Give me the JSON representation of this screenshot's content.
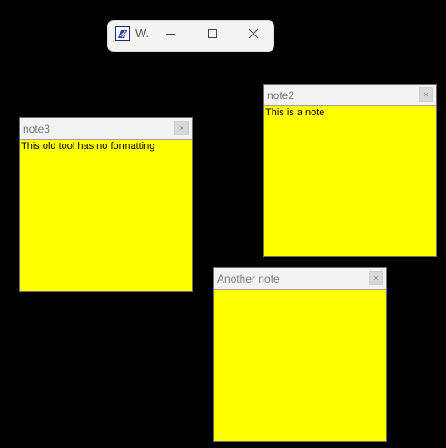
{
  "main_window": {
    "title": "W.",
    "icon": "notepad-app-icon",
    "controls": {
      "minimize": "minimize-icon",
      "maximize": "maximize-icon",
      "close": "close-icon"
    }
  },
  "notes": [
    {
      "id": "note3",
      "title": "note3",
      "content": "This old tool has no formatting"
    },
    {
      "id": "note2",
      "title": "note2",
      "content": "This is a note"
    },
    {
      "id": "note1",
      "title": "Another note",
      "content": ""
    }
  ],
  "colors": {
    "desktop_background": "#000000",
    "note_background": "#ffff00",
    "titlebar_background": "#f2f2f2",
    "title_text": "#7a7a7a"
  }
}
